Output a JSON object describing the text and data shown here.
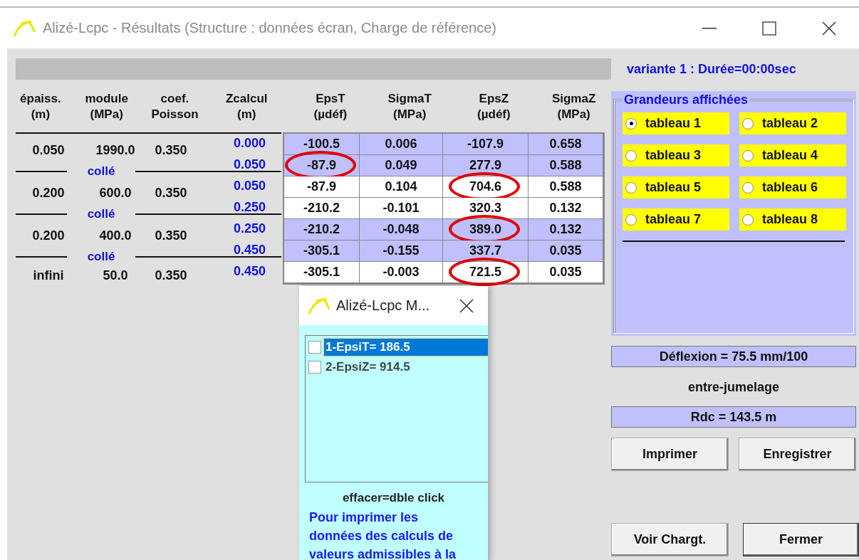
{
  "window": {
    "title": "Alizé-Lcpc - Résultats (Structure : données écran, Charge de référence)"
  },
  "variant_label": "variante 1 : Durée=00:00sec",
  "layers_table": {
    "columns": [
      {
        "label": "épaiss.",
        "unit": "(m)"
      },
      {
        "label": "module",
        "unit": "(MPa)"
      },
      {
        "label": "coef.",
        "unit": "Poisson"
      },
      {
        "label": "Zcalcul",
        "unit": "(m)"
      }
    ],
    "layers": [
      {
        "thickness": "0.050",
        "modulus": "1990.0",
        "poisson": "0.350",
        "interface": "collé"
      },
      {
        "thickness": "0.200",
        "modulus": "600.0",
        "poisson": "0.350",
        "interface": "collé"
      },
      {
        "thickness": "0.200",
        "modulus": "400.0",
        "poisson": "0.350",
        "interface": "collé"
      },
      {
        "thickness": "infini",
        "modulus": "50.0",
        "poisson": "0.350"
      }
    ],
    "z_values": [
      "0.000",
      "0.050",
      "0.050",
      "0.250",
      "0.250",
      "0.450",
      "0.450"
    ]
  },
  "results_table": {
    "columns": [
      {
        "label": "EpsT",
        "unit": "(µdéf)"
      },
      {
        "label": "SigmaT",
        "unit": "(MPa)"
      },
      {
        "label": "EpsZ",
        "unit": "(µdéf)"
      },
      {
        "label": "SigmaZ",
        "unit": "(MPa)"
      }
    ],
    "rows": [
      {
        "highlighted": true,
        "cells": [
          {
            "text": "-100.5",
            "circled": false
          },
          {
            "text": "0.006",
            "circled": false
          },
          {
            "text": "-107.9",
            "circled": false
          },
          {
            "text": "0.658",
            "circled": false
          }
        ]
      },
      {
        "highlighted": true,
        "cells": [
          {
            "text": "-87.9",
            "circled": true
          },
          {
            "text": "0.049",
            "circled": false
          },
          {
            "text": "277.9",
            "circled": false
          },
          {
            "text": "0.588",
            "circled": false
          }
        ]
      },
      {
        "highlighted": false,
        "cells": [
          {
            "text": "-87.9",
            "circled": false
          },
          {
            "text": "0.104",
            "circled": false
          },
          {
            "text": "704.6",
            "circled": true
          },
          {
            "text": "0.588",
            "circled": false
          }
        ]
      },
      {
        "highlighted": false,
        "cells": [
          {
            "text": "-210.2",
            "circled": false
          },
          {
            "text": "-0.101",
            "circled": false
          },
          {
            "text": "320.3",
            "circled": false
          },
          {
            "text": "0.132",
            "circled": false
          }
        ]
      },
      {
        "highlighted": true,
        "cells": [
          {
            "text": "-210.2",
            "circled": false
          },
          {
            "text": "-0.048",
            "circled": false
          },
          {
            "text": "389.0",
            "circled": true
          },
          {
            "text": "0.132",
            "circled": false
          }
        ]
      },
      {
        "highlighted": true,
        "cells": [
          {
            "text": "-305.1",
            "circled": false
          },
          {
            "text": "-0.155",
            "circled": false
          },
          {
            "text": "337.7",
            "circled": false
          },
          {
            "text": "0.035",
            "circled": false
          }
        ]
      },
      {
        "highlighted": false,
        "cells": [
          {
            "text": "-305.1",
            "circled": false
          },
          {
            "text": "-0.003",
            "circled": false
          },
          {
            "text": "721.5",
            "circled": true
          },
          {
            "text": "0.035",
            "circled": false
          }
        ]
      }
    ]
  },
  "display_group": {
    "title": "Grandeurs affichées",
    "options": [
      {
        "label": "tableau 1",
        "selected": true
      },
      {
        "label": "tableau 2",
        "selected": false
      },
      {
        "label": "tableau 3",
        "selected": false
      },
      {
        "label": "tableau 4",
        "selected": false
      },
      {
        "label": "tableau 5",
        "selected": false
      },
      {
        "label": "tableau 6",
        "selected": false
      },
      {
        "label": "tableau 7",
        "selected": false
      },
      {
        "label": "tableau 8",
        "selected": false
      }
    ]
  },
  "deflection": "Déflexion = 75.5 mm/100",
  "position_label": "entre-jumelage",
  "radius": "Rdc = 143.5 m",
  "buttons": [
    {
      "label": "Imprimer",
      "default": false
    },
    {
      "label": "Enregistrer",
      "default": false
    }
  ],
  "bottom_buttons": [
    {
      "label": "Voir Chargt.",
      "default": false
    },
    {
      "label": "Fermer",
      "default": true
    }
  ],
  "popup": {
    "title": "Alizé-Lcpc M...",
    "items": [
      {
        "label": "1-EpsiT= 186.5",
        "checked": false,
        "selected": true
      },
      {
        "label": "2-EpsiZ= 914.5",
        "checked": false,
        "selected": false
      }
    ],
    "hint": "effacer=dble click",
    "note": "Pour imprimer les\ndonnées des calculs de\nvaleurs admissibles à la"
  }
}
